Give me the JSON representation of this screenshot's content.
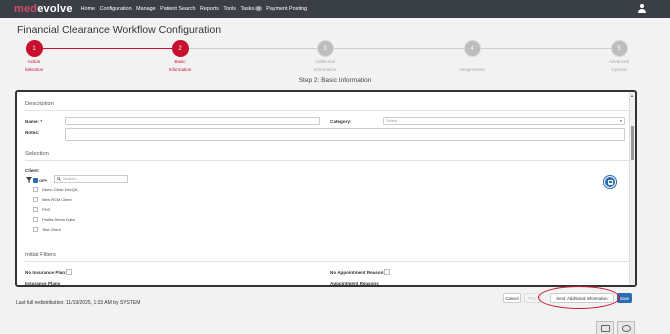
{
  "brand": {
    "part1": "med",
    "part2": "evolve"
  },
  "nav": {
    "items": [
      "Home",
      "Configuration",
      "Manage",
      "Patient Search",
      "Reports",
      "Tools",
      "Tasks",
      "Payment Posting"
    ],
    "tasks_badge": "0"
  },
  "page_title": "Financial Clearance Workflow Configuration",
  "steps": [
    {
      "number": "1",
      "label1": "Action",
      "label2": "Selection",
      "state": "active"
    },
    {
      "number": "2",
      "label1": "Basic",
      "label2": "Information",
      "state": "active"
    },
    {
      "number": "3",
      "label1": "Additional",
      "label2": "Information",
      "state": "inactive"
    },
    {
      "number": "4",
      "label1": "Assignments",
      "label2": "",
      "state": "inactive"
    },
    {
      "number": "5",
      "label1": "Advanced",
      "label2": "Options",
      "state": "inactive"
    }
  ],
  "step_heading": "Step 2: Basic Information",
  "description": {
    "title": "Description",
    "name_label": "Name: *",
    "category_label": "Category:",
    "category_placeholder": "Select...",
    "notes_label": "Notes:"
  },
  "selection": {
    "title": "Selection",
    "clients_label": "Client:",
    "filter_state": "OFF",
    "search_placeholder": "Search...",
    "clients": [
      "Demo Clinic DevQA",
      "New RCM Client",
      "PHS",
      "Pruitts Demo Data",
      "Test Client"
    ]
  },
  "initial_filters": {
    "title": "Initial Filters",
    "no_insurance_label": "No Insurance Plan:",
    "no_appointment_label": "No Appointment Reason:",
    "insurance_label": "Insurance Plans",
    "appointment_label": "Appointment Reasons"
  },
  "footer": {
    "last_run": "Last full redistribution: 11/19/2025, 1:33 AM by SYSTEM",
    "cancel": "Cancel",
    "prev": "Prev",
    "next_info": "Next: Additional Information",
    "save": "Save"
  },
  "colors": {
    "accent": "#c8102e",
    "primary": "#2b6cb0",
    "nav_bg": "#3a3f45"
  }
}
